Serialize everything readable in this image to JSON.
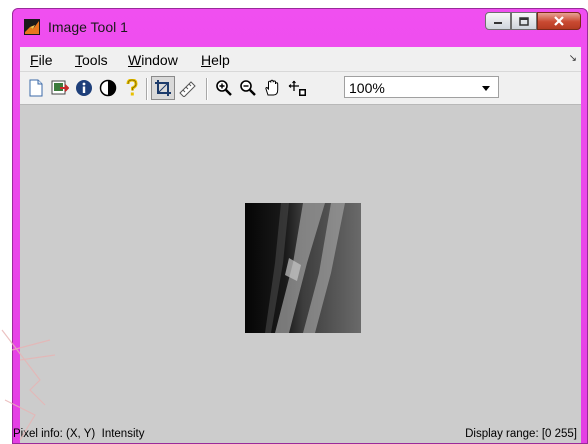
{
  "window": {
    "title": "Image Tool 1"
  },
  "menu": {
    "items": [
      {
        "mnemonic": "F",
        "rest": "ile"
      },
      {
        "mnemonic": "T",
        "rest": "ools"
      },
      {
        "mnemonic": "W",
        "rest": "indow"
      },
      {
        "mnemonic": "H",
        "rest": "elp"
      }
    ]
  },
  "toolbar": {
    "icons": [
      "new-figure-icon",
      "export-image-icon",
      "image-info-icon",
      "contrast-icon",
      "help-icon",
      "crop-icon",
      "distance-tool-icon",
      "zoom-in-icon",
      "zoom-out-icon",
      "pan-hand-icon",
      "pixel-region-icon"
    ],
    "zoom_value": "100%"
  },
  "status": {
    "pixel_info": "Pixel info: (X, Y)  Intensity",
    "display_range": "Display range: [0 255]"
  },
  "colors": {
    "titlebar": "#e848e8",
    "client_bg": "#cccccc",
    "toolbar_bg": "#f0f0f0",
    "close_button": "#c94a32"
  }
}
